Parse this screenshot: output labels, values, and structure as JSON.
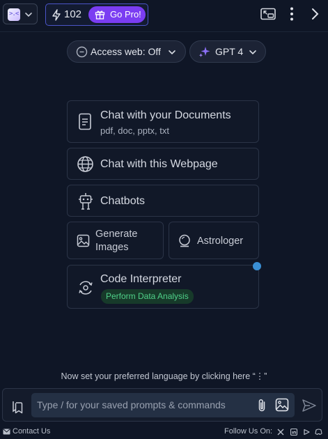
{
  "topbar": {
    "credits": "102",
    "gopro_label": "Go Pro!"
  },
  "toolbar": {
    "web_access_label": "Access web: Off",
    "model_label": "GPT 4"
  },
  "cards": {
    "documents": {
      "title": "Chat with your Documents",
      "subtitle": "pdf, doc, pptx, txt"
    },
    "webpage": {
      "title": "Chat with this Webpage"
    },
    "chatbots": {
      "title": "Chatbots"
    },
    "generate_images": {
      "title_line1": "Generate",
      "title_line2": "Images"
    },
    "astrologer": {
      "title": "Astrologer"
    },
    "code_interpreter": {
      "title": "Code Interpreter",
      "tag": "Perform Data Analysis"
    }
  },
  "hint": "Now set your preferred language by clicking here “⋮”",
  "composer": {
    "placeholder": "Type / for your saved prompts & commands"
  },
  "footer": {
    "contact": "Contact Us",
    "follow": "Follow Us On:"
  },
  "colors": {
    "background": "#0f1626",
    "accent_purple": "#7b3df2",
    "tag_green": "#4fd189",
    "notification_dot": "#3a8fd4"
  }
}
